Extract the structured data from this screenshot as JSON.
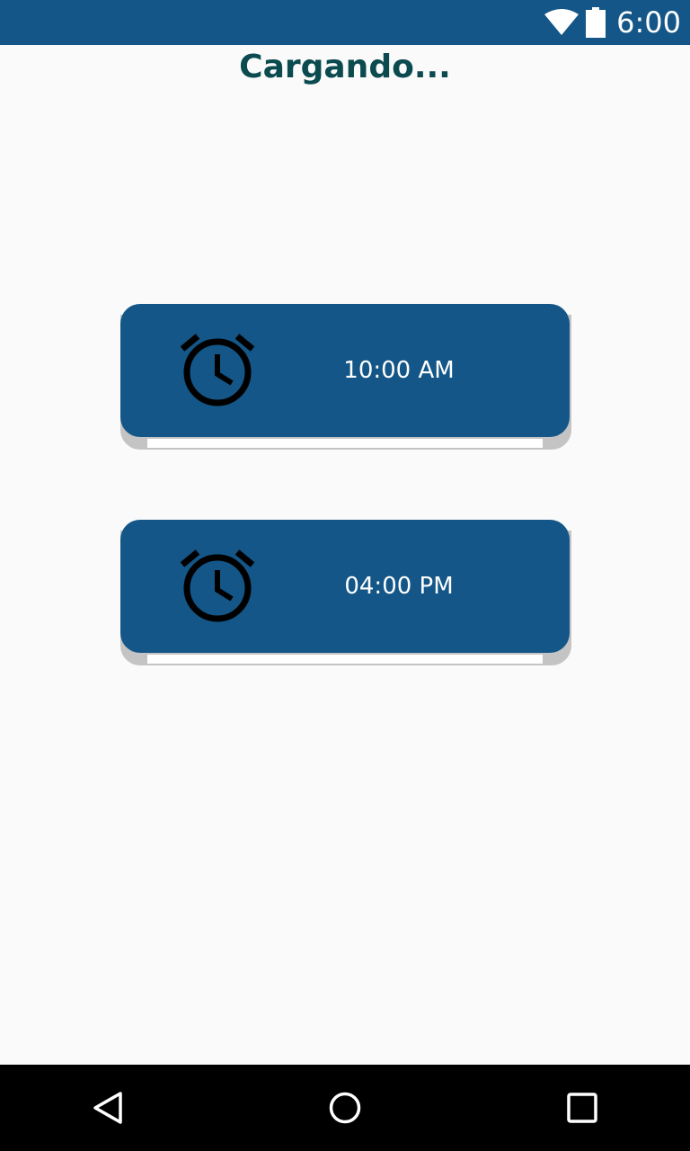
{
  "status_bar": {
    "time": "6:00",
    "icons": [
      "wifi-icon",
      "battery-icon"
    ],
    "background": "#135687"
  },
  "header": {
    "title": "Cargando..."
  },
  "alarms": [
    {
      "time": "10:00 AM",
      "icon": "alarm-clock-icon"
    },
    {
      "time": "04:00 PM",
      "icon": "alarm-clock-icon"
    }
  ],
  "nav_bar": {
    "buttons": [
      "back-icon",
      "home-icon",
      "recents-icon"
    ]
  },
  "colors": {
    "accent": "#135687",
    "title": "#0b4a4f",
    "background": "#fafafa"
  }
}
